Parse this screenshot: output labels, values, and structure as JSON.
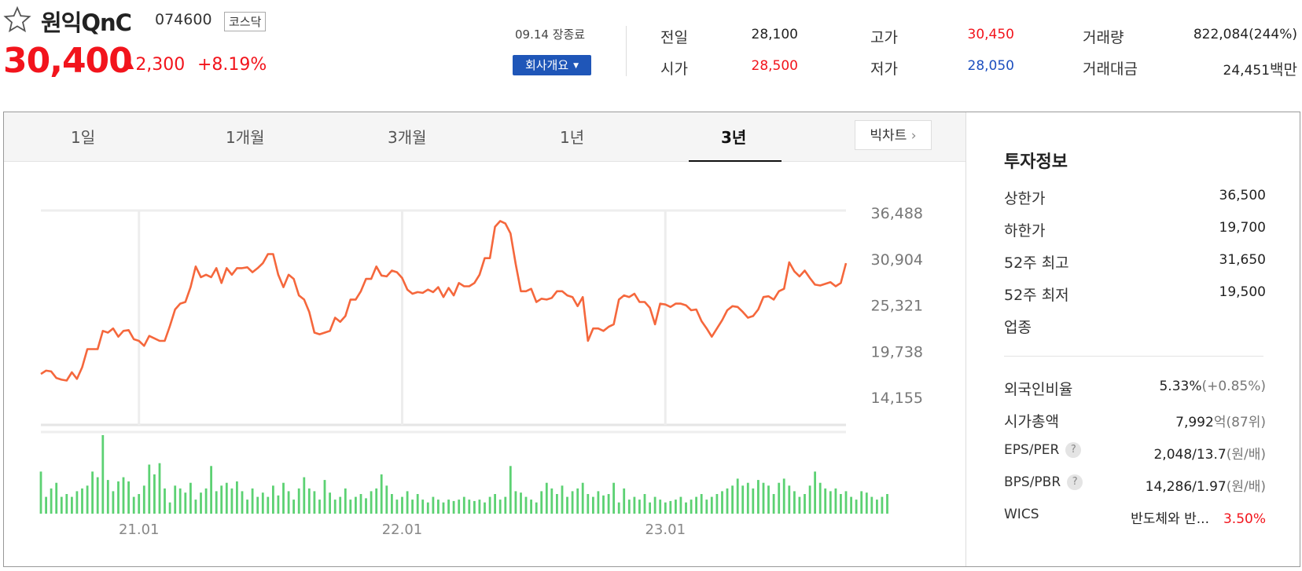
{
  "stock": {
    "name": "원익QnC",
    "code": "074600",
    "market": "코스닥",
    "price": "30,400",
    "change_arrow": "▲",
    "change": "2,300",
    "change_pct": "+8.19%"
  },
  "session": {
    "date_status": "09.14 장종료",
    "company_button": "회사개요"
  },
  "summary": [
    {
      "label": "전일",
      "value": "28,100",
      "color": "default"
    },
    {
      "label": "고가",
      "value": "30,450",
      "color": "red"
    },
    {
      "label": "거래량",
      "value": "822,084(244%)",
      "color": "default"
    },
    {
      "label": "시가",
      "value": "28,500",
      "color": "red"
    },
    {
      "label": "저가",
      "value": "28,050",
      "color": "blue"
    },
    {
      "label": "거래대금",
      "value": "24,451",
      "unit": "백만",
      "color": "default"
    }
  ],
  "tabs": [
    {
      "label": "1일",
      "active": false
    },
    {
      "label": "1개월",
      "active": false
    },
    {
      "label": "3개월",
      "active": false
    },
    {
      "label": "1년",
      "active": false
    },
    {
      "label": "3년",
      "active": true
    }
  ],
  "big_chart_button": "빅차트",
  "chart_data": {
    "type": "line",
    "yticks": [
      "36,488",
      "30,904",
      "25,321",
      "19,738",
      "14,155"
    ],
    "ytick_values": [
      36488,
      30904,
      25321,
      19738,
      14155
    ],
    "xticks": [
      {
        "label": "21.01",
        "index": 19
      },
      {
        "label": "22.01",
        "index": 70
      },
      {
        "label": "23.01",
        "index": 121
      }
    ],
    "price_series": [
      17000,
      17400,
      17300,
      16500,
      16300,
      16200,
      17200,
      16400,
      17800,
      20000,
      20000,
      20000,
      22200,
      22000,
      22500,
      21500,
      22200,
      22300,
      21200,
      21000,
      20400,
      21600,
      21300,
      21000,
      21000,
      22800,
      24800,
      25500,
      25700,
      27500,
      30000,
      28700,
      29000,
      28700,
      29800,
      28000,
      29800,
      29000,
      29800,
      29800,
      29900,
      29300,
      29800,
      30400,
      31500,
      31500,
      29000,
      27500,
      29000,
      28500,
      26500,
      26000,
      24500,
      22000,
      21800,
      22000,
      22200,
      23800,
      23300,
      24000,
      26000,
      26000,
      27000,
      28500,
      28500,
      30000,
      28900,
      28800,
      29500,
      29300,
      28600,
      27200,
      26700,
      26900,
      26800,
      27200,
      26900,
      27500,
      26300,
      27400,
      26500,
      28000,
      27600,
      27600,
      28000,
      29000,
      31000,
      31000,
      34800,
      35500,
      35200,
      34000,
      30300,
      27000,
      27000,
      27300,
      25700,
      26100,
      26000,
      26200,
      27000,
      27000,
      26500,
      26300,
      25200,
      26300,
      21000,
      22500,
      22500,
      22200,
      22700,
      23000,
      26000,
      26500,
      26300,
      26700,
      25700,
      25700,
      25000,
      23000,
      25500,
      25400,
      25100,
      25500,
      25500,
      25300,
      24700,
      24800,
      23400,
      22500,
      21500,
      22500,
      23500,
      24700,
      25200,
      25100,
      24500,
      23800,
      24000,
      24800,
      26300,
      26400,
      26000,
      27000,
      27300,
      30500,
      29400,
      28800,
      29500,
      28600,
      27800,
      27700,
      27900,
      28100,
      27600,
      28000,
      30400
    ],
    "volume_series": [
      0.3,
      0.12,
      0.18,
      0.22,
      0.12,
      0.14,
      0.12,
      0.16,
      0.18,
      0.2,
      0.3,
      0.26,
      0.56,
      0.24,
      0.16,
      0.23,
      0.26,
      0.23,
      0.12,
      0.14,
      0.2,
      0.35,
      0.28,
      0.36,
      0.18,
      0.08,
      0.2,
      0.18,
      0.15,
      0.22,
      0.1,
      0.15,
      0.18,
      0.34,
      0.16,
      0.2,
      0.22,
      0.18,
      0.23,
      0.16,
      0.1,
      0.18,
      0.12,
      0.15,
      0.12,
      0.2,
      0.13,
      0.22,
      0.16,
      0.1,
      0.18,
      0.26,
      0.18,
      0.16,
      0.1,
      0.24,
      0.15,
      0.1,
      0.12,
      0.18,
      0.1,
      0.12,
      0.14,
      0.11,
      0.16,
      0.18,
      0.28,
      0.2,
      0.14,
      0.1,
      0.12,
      0.16,
      0.1,
      0.14,
      0.1,
      0.08,
      0.12,
      0.1,
      0.08,
      0.1,
      0.09,
      0.1,
      0.12,
      0.1,
      0.09,
      0.1,
      0.08,
      0.12,
      0.14,
      0.1,
      0.12,
      0.34,
      0.16,
      0.15,
      0.12,
      0.1,
      0.08,
      0.16,
      0.22,
      0.18,
      0.14,
      0.2,
      0.12,
      0.16,
      0.18,
      0.22,
      0.14,
      0.12,
      0.16,
      0.13,
      0.14,
      0.22,
      0.08,
      0.18,
      0.1,
      0.12,
      0.1,
      0.14,
      0.08,
      0.12,
      0.1,
      0.08,
      0.09,
      0.1,
      0.12,
      0.08,
      0.1,
      0.12,
      0.14,
      0.1,
      0.12,
      0.14,
      0.16,
      0.18,
      0.2,
      0.25,
      0.2,
      0.22,
      0.18,
      0.24,
      0.22,
      0.2,
      0.14,
      0.22,
      0.25,
      0.2,
      0.16,
      0.12,
      0.14,
      0.2,
      0.3,
      0.22,
      0.18,
      0.16,
      0.18,
      0.14,
      0.16,
      0.12,
      0.1,
      0.16,
      0.15,
      0.12,
      0.1,
      0.12,
      0.14
    ]
  },
  "invest": {
    "title": "투자정보",
    "rows": [
      {
        "label": "상한가",
        "value": "36,500",
        "color": "red"
      },
      {
        "label": "하한가",
        "value": "19,700",
        "color": "blue"
      },
      {
        "label": "52주 최고",
        "value": "31,650",
        "color": "default"
      },
      {
        "label": "52주 최저",
        "value": "19,500",
        "color": "default"
      },
      {
        "label": "업종",
        "value": "",
        "color": "default"
      }
    ],
    "rows2": [
      {
        "label": "외국인비율",
        "value": "5.33%",
        "unit": "(+0.85%)",
        "help": false
      },
      {
        "label": "시가총액",
        "value": "7,992",
        "unit": "억(87위)",
        "help": false
      },
      {
        "label": "EPS/PER",
        "value": "2,048/13.7",
        "unit": "(원/배)",
        "help": true
      },
      {
        "label": "BPS/PBR",
        "value": "14,286/1.97",
        "unit": "(원/배)",
        "help": true
      },
      {
        "label": "WICS",
        "value": "반도체와 반...",
        "pct": "3.50%",
        "help": false
      }
    ],
    "help_glyph": "?"
  },
  "colors": {
    "line": "#f5673c",
    "volume": "#5cd173",
    "red": "#f2141c",
    "blue": "#1d4fbf",
    "accent": "#1f56b8"
  }
}
